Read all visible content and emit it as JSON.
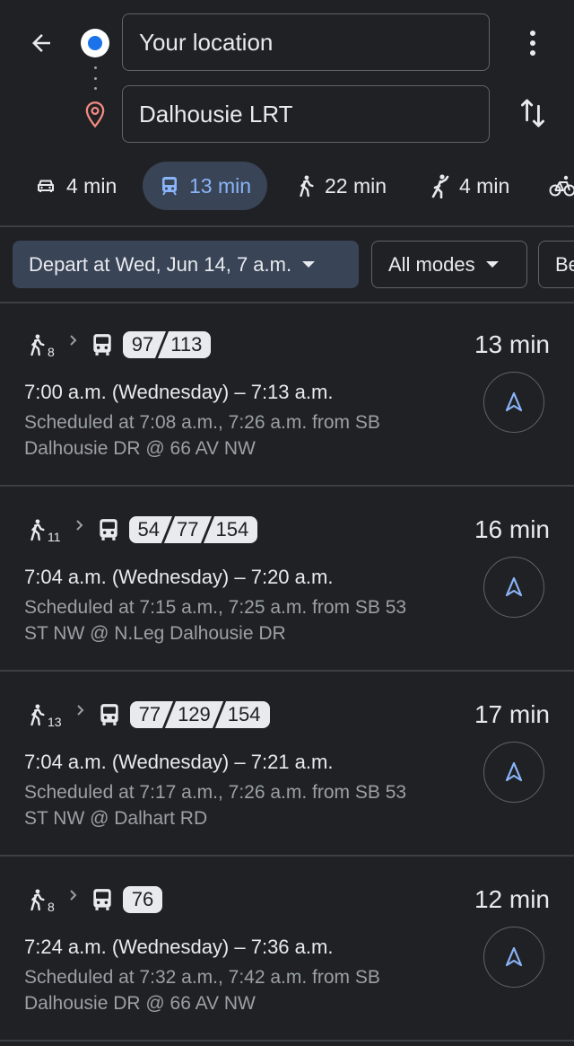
{
  "search": {
    "origin": "Your location",
    "destination": "Dalhousie LRT"
  },
  "modes": [
    {
      "icon": "car-icon",
      "label": "4 min",
      "active": false
    },
    {
      "icon": "transit-icon",
      "label": "13 min",
      "active": true
    },
    {
      "icon": "walk-icon",
      "label": "22 min",
      "active": false
    },
    {
      "icon": "rideshare-icon",
      "label": "4 min",
      "active": false
    },
    {
      "icon": "bike-icon",
      "label": "",
      "active": false
    }
  ],
  "filters": {
    "depart": "Depart at Wed, Jun 14, 7 a.m.",
    "modes": "All modes",
    "best": "Be"
  },
  "colors": {
    "background": "#202124",
    "accent": "#8ab4f8",
    "active_chip": "#394457",
    "origin_dot": "#1a73e8",
    "destination_pin": "#f28b82"
  },
  "routes": [
    {
      "walk_minutes": "8",
      "buses": [
        "97",
        "113"
      ],
      "duration": "13 min",
      "times": "7:00 a.m. (Wednesday) – 7:13 a.m.",
      "schedule_line1": "Scheduled at 7:08 a.m., 7:26 a.m. from SB",
      "schedule_line2": "Dalhousie DR @ 66 AV NW"
    },
    {
      "walk_minutes": "11",
      "buses": [
        "54",
        "77",
        "154"
      ],
      "duration": "16 min",
      "times": "7:04 a.m. (Wednesday) – 7:20 a.m.",
      "schedule_line1": "Scheduled at 7:15 a.m., 7:25 a.m. from SB 53",
      "schedule_line2": "ST NW @ N.Leg Dalhousie DR"
    },
    {
      "walk_minutes": "13",
      "buses": [
        "77",
        "129",
        "154"
      ],
      "duration": "17 min",
      "times": "7:04 a.m. (Wednesday) – 7:21 a.m.",
      "schedule_line1": "Scheduled at 7:17 a.m., 7:26 a.m. from SB 53",
      "schedule_line2": "ST NW @ Dalhart RD"
    },
    {
      "walk_minutes": "8",
      "buses": [
        "76"
      ],
      "duration": "12 min",
      "times": "7:24 a.m. (Wednesday) – 7:36 a.m.",
      "schedule_line1": "Scheduled at 7:32 a.m., 7:42 a.m. from SB",
      "schedule_line2": "Dalhousie DR @ 66 AV NW"
    }
  ]
}
